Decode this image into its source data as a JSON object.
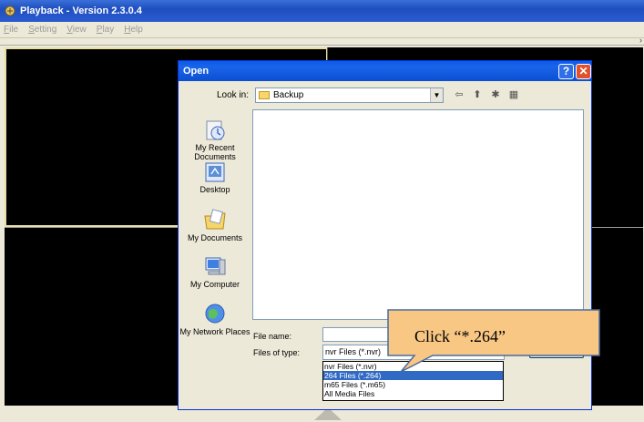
{
  "app": {
    "title": "Playback - Version 2.3.0.4",
    "menu": [
      {
        "label": "File",
        "u": "F",
        "rest": "ile"
      },
      {
        "label": "Setting",
        "u": "S",
        "rest": "etting"
      },
      {
        "label": "View",
        "u": "V",
        "rest": "iew"
      },
      {
        "label": "Play",
        "u": "P",
        "rest": "lay"
      },
      {
        "label": "Help",
        "u": "H",
        "rest": "elp"
      }
    ],
    "scroll_arrow": "›"
  },
  "dialog": {
    "title": "Open",
    "help_label": "?",
    "close_label": "✕",
    "look_in_label": "Look in:",
    "look_in_value": "Backup",
    "places": [
      {
        "label": "My Recent Documents",
        "icon": "recent-documents-icon"
      },
      {
        "label": "Desktop",
        "icon": "desktop-icon"
      },
      {
        "label": "My Documents",
        "icon": "my-documents-icon"
      },
      {
        "label": "My Computer",
        "icon": "my-computer-icon"
      },
      {
        "label": "My Network Places",
        "icon": "network-places-icon"
      }
    ],
    "file_name_label": "File name:",
    "file_name_value": "",
    "files_of_type_label": "Files of type:",
    "files_of_type_value": "nvr Files (*.nvr)",
    "file_type_options": [
      {
        "label": "nvr Files (*.nvr)",
        "selected": false
      },
      {
        "label": "264 Files (*.264)",
        "selected": true
      },
      {
        "label": "m65 Files (*.m65)",
        "selected": false
      },
      {
        "label": "All Media Files",
        "selected": false
      }
    ]
  },
  "annotation": {
    "text": "Click “*.264”",
    "fill_color": "#f9c784",
    "border_color": "#4a6b9d"
  }
}
